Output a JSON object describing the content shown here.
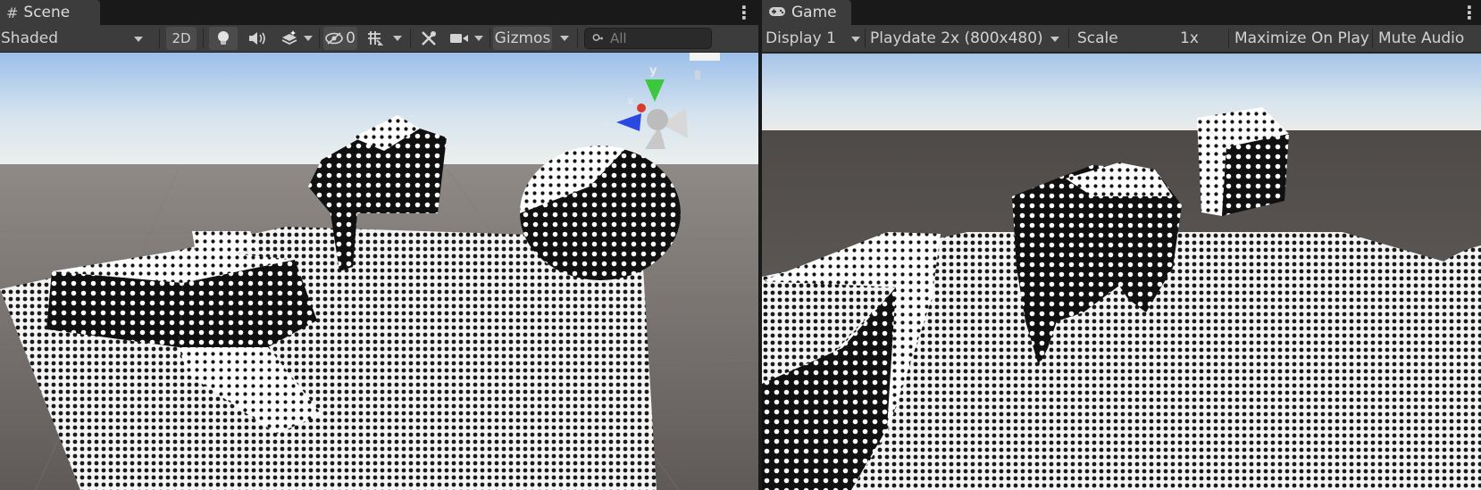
{
  "scene": {
    "tab_label": "Scene",
    "tab_icon": "hash-icon",
    "menu_icon": "kebab-menu-icon",
    "shading_mode": "Shaded",
    "toggle_2d": "2D",
    "hidden_count": "0",
    "gizmos_label": "Gizmos",
    "search_placeholder": "All",
    "orientation_gizmo": {
      "y_axis": "y",
      "x_axis": "x",
      "z_axis": "z"
    }
  },
  "game": {
    "tab_label": "Game",
    "tab_icon": "gamepad-icon",
    "menu_icon": "kebab-menu-icon",
    "display": "Display 1",
    "resolution": "Playdate 2x (800x480)",
    "scale_label": "Scale",
    "scale_value": "1x",
    "maximize_label": "Maximize On Play",
    "mute_label": "Mute Audio"
  },
  "colors": {
    "toolbar_bg": "#3c3c3c",
    "tab_bg": "#3c3c3c",
    "editor_bg": "#191919",
    "sky_top": "#9fc2ea",
    "ground": "#6b6664",
    "axis_x": "#d83b2b",
    "axis_y": "#3cc83c",
    "axis_z": "#2b48e0"
  }
}
